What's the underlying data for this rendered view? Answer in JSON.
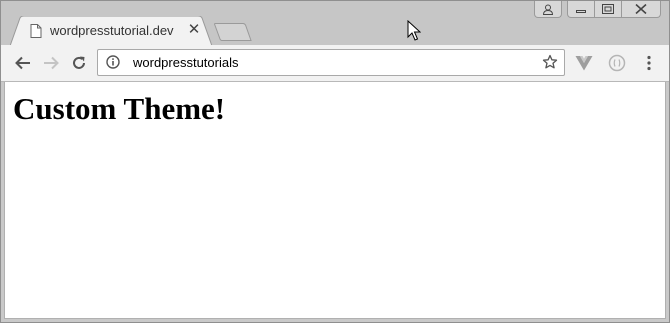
{
  "tab": {
    "title": "wordpresstutorial.dev",
    "favicon": "page-icon"
  },
  "window_controls": [
    "user-icon",
    "minimize-icon",
    "maximize-icon",
    "close-icon"
  ],
  "toolbar": {
    "back": "back-arrow-icon",
    "forward": "forward-arrow-icon",
    "reload": "reload-icon"
  },
  "omnibox": {
    "info_icon": "info-icon",
    "url": "wordpresstutorials",
    "bookmark_icon": "star-icon"
  },
  "extensions": [
    "vue-devtools-icon",
    "extension-circle-icon"
  ],
  "menu_icon": "vertical-dots-icon",
  "page": {
    "heading": "Custom Theme!"
  },
  "colors": {
    "titlebar": "#c6c6c6",
    "toolbar": "#f2f2f2",
    "tab": "#f2f2f2"
  }
}
